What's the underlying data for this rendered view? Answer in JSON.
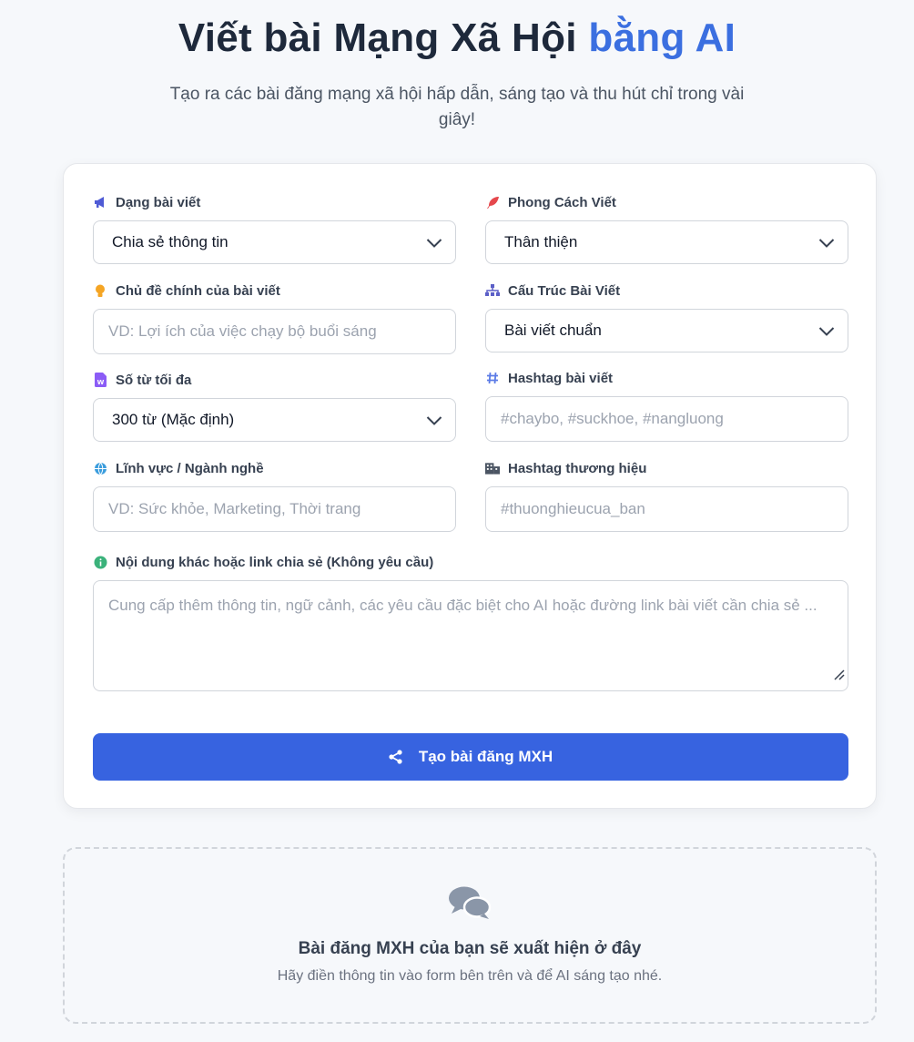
{
  "header": {
    "title_main": "Viết bài Mạng Xã Hội ",
    "title_accent": "bằng AI",
    "subtitle": "Tạo ra các bài đăng mạng xã hội hấp dẫn, sáng tạo và thu hút chỉ trong vài giây!"
  },
  "form": {
    "post_type": {
      "label": "Dạng bài viết",
      "value": "Chia sẻ thông tin",
      "icon": "megaphone-icon"
    },
    "writing_style": {
      "label": "Phong Cách Viết",
      "value": "Thân thiện",
      "icon": "feather-icon"
    },
    "topic": {
      "label": "Chủ đề chính của bài viết",
      "placeholder": "VD: Lợi ích của việc chạy bộ buổi sáng",
      "icon": "lightbulb-icon"
    },
    "structure": {
      "label": "Cấu Trúc Bài Viết",
      "value": "Bài viết chuẩn",
      "icon": "sitemap-icon"
    },
    "max_words": {
      "label": "Số từ tối đa",
      "value": "300 từ (Mặc định)",
      "icon": "word-file-icon"
    },
    "hashtags": {
      "label": "Hashtag bài viết",
      "placeholder": "#chaybo, #suckhoe, #nangluong",
      "icon": "hashtag-icon"
    },
    "industry": {
      "label": "Lĩnh vực / Ngành nghề",
      "placeholder": "VD: Sức khỏe, Marketing, Thời trang",
      "icon": "globe-icon"
    },
    "brand_hashtag": {
      "label": "Hashtag thương hiệu",
      "placeholder": "#thuonghieucua_ban",
      "icon": "building-icon"
    },
    "extra": {
      "label": "Nội dung khác hoặc link chia sẻ (Không yêu cầu)",
      "placeholder": "Cung cấp thêm thông tin, ngữ cảnh, các yêu cầu đặc biệt cho AI hoặc đường link bài viết cần chia sẻ ...",
      "icon": "info-circle-icon"
    },
    "submit_label": "Tạo bài đăng MXH"
  },
  "output": {
    "title": "Bài đăng MXH của bạn sẽ xuất hiện ở đây",
    "subtitle": "Hãy điền thông tin vào form bên trên và để AI sáng tạo nhé."
  },
  "colors": {
    "accent": "#3b6fe0",
    "button": "#3763e0",
    "background": "#f6f8fb"
  }
}
